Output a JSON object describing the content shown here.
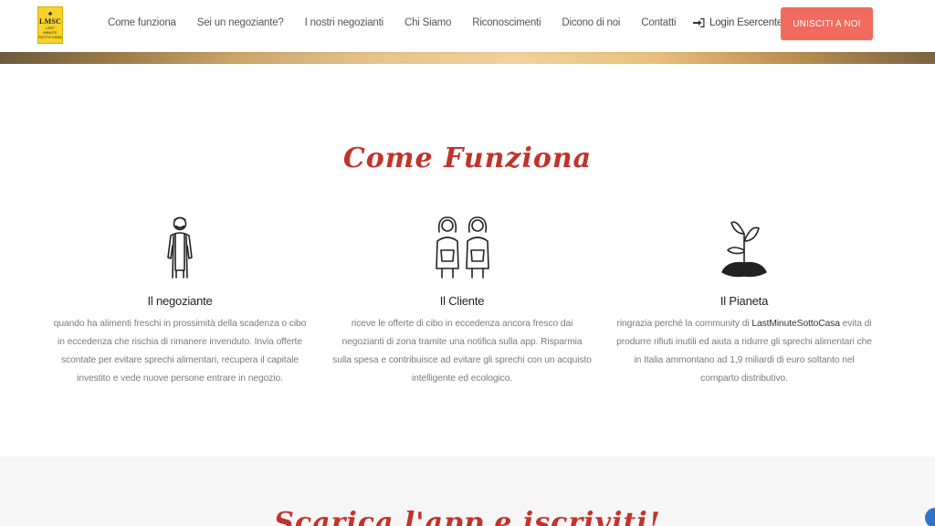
{
  "header": {
    "logo_text": "LMSC",
    "logo_sub": "LAST MINUTE SOTTO CASA",
    "nav": [
      "Come funziona",
      "Sei un negoziante?",
      "I nostri negozianti",
      "Chi Siamo",
      "Riconoscimenti",
      "Dicono di noi",
      "Contatti"
    ],
    "login_label": "Login Esercente",
    "join_label": "UNISCITI A NOI"
  },
  "how": {
    "title": "Come Funziona",
    "items": [
      {
        "title": "Il negoziante",
        "text": "quando ha alimenti freschi in prossimità della scadenza o cibo in eccedenza che rischia di rimanere invenduto. Invia offerte scontate per evitare sprechi alimentari, recupera il capitale investito e vede nuove persone entrare in negozio."
      },
      {
        "title": "Il Cliente",
        "text": "riceve le offerte di cibo in eccedenza ancora fresco dai negozianti di zona tramite una notifica sulla app. Risparmia sulla spesa e contribuisce ad evitare gli sprechi con un acquisto intelligente ed ecologico."
      },
      {
        "title": "Il Pianeta",
        "text_before": "ringrazia perché la community di ",
        "brand": "LastMinuteSottoCasa",
        "text_after": " evita di produrre rifiuti inutili ed aiuta a ridurre gli sprechi alimentari che in Italia ammontano ad 1,9 miliardi di euro soltanto nel comparto distributivo."
      }
    ]
  },
  "download": {
    "title": "Scarica l'app e iscriviti!"
  },
  "colors": {
    "accent": "#c2332b",
    "button": "#f06a5e",
    "logo_yellow": "#f5d22c"
  }
}
